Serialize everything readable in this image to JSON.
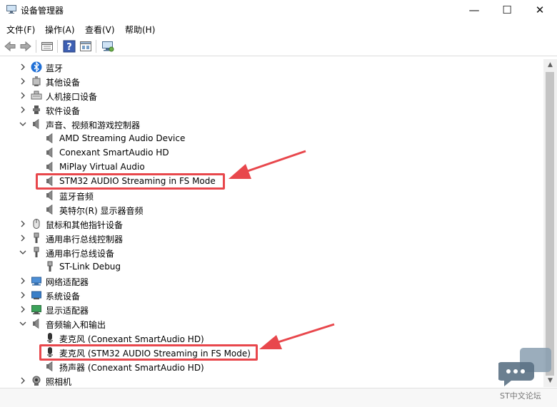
{
  "window": {
    "title": "设备管理器",
    "minimize_glyph": "—",
    "maximize_glyph": "☐",
    "close_glyph": "✕"
  },
  "menu": [
    "文件(F)",
    "操作(A)",
    "查看(V)",
    "帮助(H)"
  ],
  "toolbar": {
    "icons": [
      "back-icon",
      "forward-icon",
      "properties-icon",
      "help-icon",
      "view-icon",
      "scan-hardware-icon"
    ]
  },
  "tree": {
    "items": [
      {
        "label": "蓝牙",
        "level": 0,
        "expanded": false,
        "icon": "bluetooth-icon"
      },
      {
        "label": "其他设备",
        "level": 0,
        "expanded": false,
        "icon": "unknown-device-icon"
      },
      {
        "label": "人机接口设备",
        "level": 0,
        "expanded": false,
        "icon": "hid-icon"
      },
      {
        "label": "软件设备",
        "level": 0,
        "expanded": false,
        "icon": "software-device-icon"
      },
      {
        "label": "声音、视频和游戏控制器",
        "level": 0,
        "expanded": true,
        "icon": "speaker-icon"
      },
      {
        "label": "AMD Streaming Audio Device",
        "level": 1,
        "icon": "speaker-icon"
      },
      {
        "label": "Conexant SmartAudio HD",
        "level": 1,
        "icon": "speaker-icon"
      },
      {
        "label": "MiPlay Virtual Audio",
        "level": 1,
        "icon": "speaker-icon"
      },
      {
        "label": "STM32 AUDIO Streaming in FS Mode",
        "level": 1,
        "icon": "speaker-icon"
      },
      {
        "label": "蓝牙音频",
        "level": 1,
        "icon": "speaker-icon"
      },
      {
        "label": "英特尔(R) 显示器音频",
        "level": 1,
        "icon": "speaker-icon"
      },
      {
        "label": "鼠标和其他指针设备",
        "level": 0,
        "expanded": false,
        "icon": "mouse-icon"
      },
      {
        "label": "通用串行总线控制器",
        "level": 0,
        "expanded": false,
        "icon": "usb-icon"
      },
      {
        "label": "通用串行总线设备",
        "level": 0,
        "expanded": true,
        "icon": "usb-icon"
      },
      {
        "label": "ST-Link Debug",
        "level": 1,
        "icon": "usb-icon"
      },
      {
        "label": "网络适配器",
        "level": 0,
        "expanded": false,
        "icon": "network-icon"
      },
      {
        "label": "系统设备",
        "level": 0,
        "expanded": false,
        "icon": "system-icon"
      },
      {
        "label": "显示适配器",
        "level": 0,
        "expanded": false,
        "icon": "display-icon"
      },
      {
        "label": "音频输入和输出",
        "level": 0,
        "expanded": true,
        "icon": "speaker-icon"
      },
      {
        "label": "麦克风 (Conexant SmartAudio HD)",
        "level": 1,
        "icon": "microphone-icon"
      },
      {
        "label": "麦克风 (STM32 AUDIO Streaming in FS Mode)",
        "level": 1,
        "icon": "microphone-icon"
      },
      {
        "label": "扬声器 (Conexant SmartAudio HD)",
        "level": 1,
        "icon": "speaker-icon"
      },
      {
        "label": "照相机",
        "level": 0,
        "expanded": false,
        "icon": "camera-icon"
      }
    ]
  },
  "watermark": "ST中文论坛",
  "colors": {
    "highlight": "#e8474c",
    "scroll_thumb": "#c4c4c4",
    "bluetooth": "#1f6fd6"
  }
}
